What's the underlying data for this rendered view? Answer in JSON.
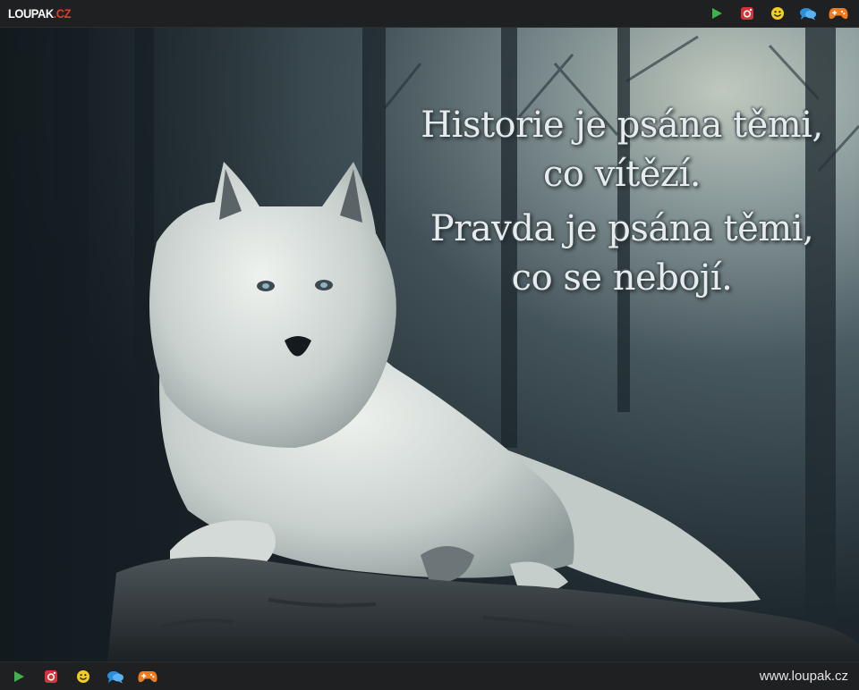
{
  "header": {
    "logo_main": "LOUPAK",
    "logo_tld": ".CZ",
    "icons": [
      "play-icon",
      "instagram-icon",
      "smiley-icon",
      "chat-icon",
      "gamepad-icon"
    ]
  },
  "image": {
    "quote_lines_1": [
      "Historie je psána těmi,",
      "co vítězí."
    ],
    "quote_lines_2": [
      "Pravda je psána těmi,",
      "co se nebojí."
    ]
  },
  "footer": {
    "icons": [
      "play-icon",
      "instagram-icon",
      "smiley-icon",
      "chat-icon",
      "gamepad-icon"
    ],
    "site_url": "www.loupak.cz"
  },
  "colors": {
    "bar_bg": "#1f2022",
    "play": "#3fb24a",
    "instagram": "#d8323a",
    "smiley": "#f2cf1e",
    "chat": "#2b8fd9",
    "gamepad": "#f07a1e",
    "logo_tld": "#e23b2e"
  }
}
